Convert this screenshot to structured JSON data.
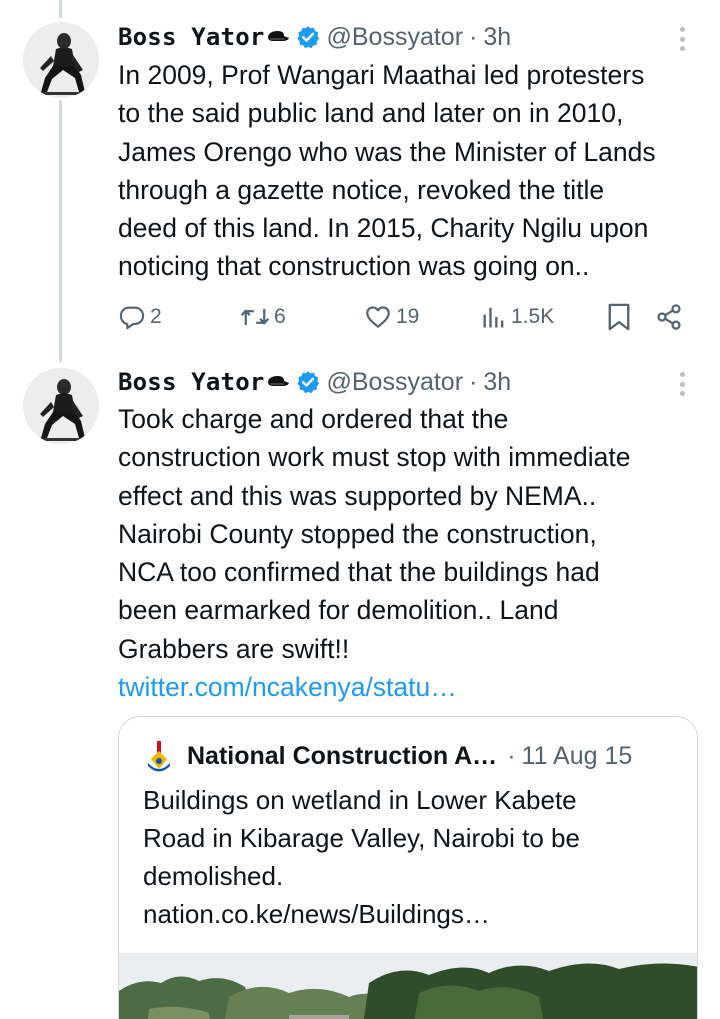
{
  "tweets": [
    {
      "author": {
        "name": "Boss Yator",
        "handle": "@Bossyator",
        "verified": true
      },
      "time": "3h",
      "text_lines": [
        "In 2009, Prof Wangari Maathai led protesters",
        "to the said public land and later on in 2010,",
        "James Orengo who was the Minister of Lands",
        "through a gazette notice, revoked the title",
        "deed of this land. In 2015, Charity Ngilu upon",
        "noticing that construction was going on.."
      ],
      "actions": {
        "replies": "2",
        "reposts": "6",
        "likes": "19",
        "views": "1.5K"
      }
    },
    {
      "author": {
        "name": "Boss Yator",
        "handle": "@Bossyator",
        "verified": true
      },
      "time": "3h",
      "text_lines": [
        "Took charge and ordered that the",
        "construction work must stop with immediate",
        "effect and this was supported by NEMA..",
        "Nairobi County stopped the construction,",
        "NCA too confirmed that the buildings had",
        "been earmarked for demolition.. Land",
        "Grabbers are swift!!"
      ],
      "link": "twitter.com/ncakenya/statu…",
      "quote": {
        "author_name": "National Construction A…",
        "date": "11 Aug 15",
        "text_lines": [
          "Buildings on wetland in Lower Kabete",
          "Road in Kibarage Valley, Nairobi to be",
          "demolished."
        ],
        "link": "nation.co.ke/news/Buildings…"
      }
    }
  ],
  "separator": "·",
  "icons": {
    "verified": "verified-badge-icon",
    "more": "more-options-icon",
    "reply": "reply-icon",
    "repost": "repost-icon",
    "like": "heart-icon",
    "views": "views-icon",
    "bookmark": "bookmark-icon",
    "share": "share-icon"
  },
  "colors": {
    "text": "#0f1419",
    "secondary": "#536471",
    "link": "#1d9bf0",
    "verified": "#1d9bf0",
    "border": "#cfd9de"
  }
}
